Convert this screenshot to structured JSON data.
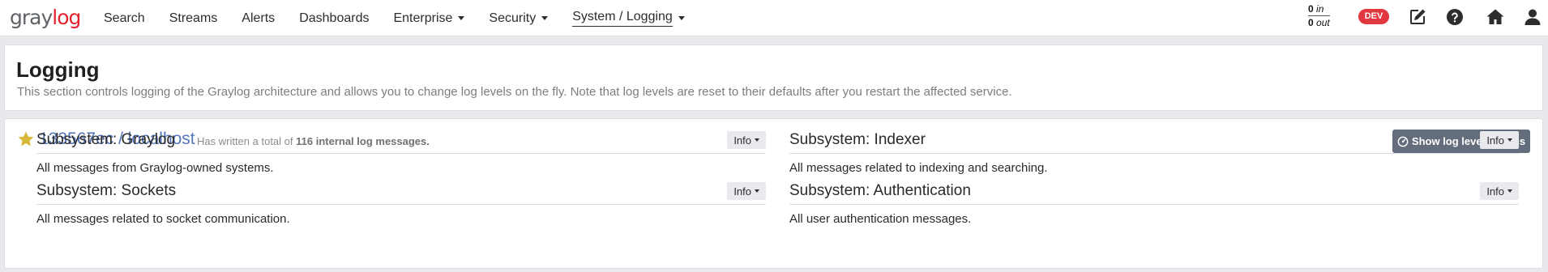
{
  "brand": {
    "name_part1": "gray",
    "name_part2": "log"
  },
  "nav": {
    "items": [
      {
        "label": "Search",
        "dropdown": false
      },
      {
        "label": "Streams",
        "dropdown": false
      },
      {
        "label": "Alerts",
        "dropdown": false
      },
      {
        "label": "Dashboards",
        "dropdown": false
      },
      {
        "label": "Enterprise",
        "dropdown": true
      },
      {
        "label": "Security",
        "dropdown": true
      },
      {
        "label": "System / Logging",
        "dropdown": true,
        "active": true
      }
    ],
    "throughput": {
      "in_value": "0",
      "in_label": "in",
      "out_value": "0",
      "out_label": "out"
    },
    "env_badge": "DEV",
    "icons": [
      "edit-icon",
      "help-icon",
      "home-icon",
      "user-icon"
    ]
  },
  "header": {
    "title": "Logging",
    "description": "This section controls logging of the Graylog architecture and allows you to change log levels on the fly. Note that log levels are reset to their defaults after you restart the affected service."
  },
  "node": {
    "name": "133567ec / localhost",
    "summary_prefix": "Has written a total of",
    "summary_count": "116 internal log messages.",
    "metrics_button": "Show log level metrics",
    "subsystems": [
      {
        "title": "Subsystem: Graylog",
        "level": "Info",
        "description": "All messages from Graylog-owned systems."
      },
      {
        "title": "Subsystem: Indexer",
        "level": "Info",
        "description": "All messages related to indexing and searching."
      },
      {
        "title": "Subsystem: Sockets",
        "level": "Info",
        "description": "All messages related to socket communication."
      },
      {
        "title": "Subsystem: Authentication",
        "level": "Info",
        "description": "All user authentication messages."
      }
    ]
  },
  "colors": {
    "brand_accent": "#e3232f",
    "badge": "#e3373f",
    "link": "#5476b8",
    "star": "#d9b93a",
    "metrics_button": "#646d7b"
  }
}
